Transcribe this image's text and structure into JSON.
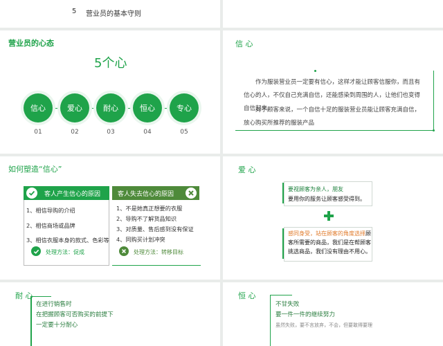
{
  "slide1": {
    "index": "5",
    "title": "营业员的基本守则"
  },
  "slide3": {
    "title": "营业员的心态",
    "heading": "5个心",
    "circles": [
      "信心",
      "爱心",
      "耐心",
      "恒心",
      "专心"
    ],
    "numbers": [
      "01",
      "02",
      "03",
      "04",
      "05"
    ]
  },
  "slide4": {
    "title": "信 心",
    "paragraph1": "作为服装营业员一定要有信心，这样才能让顾客信服你，而且有信心的人，不仅自己充满自信，还能感染到周围的人，让他们也变得自信起来。",
    "paragraph2": "对于顾客来说，一个自信十足的服装营业员能让顾客充满自信，放心购买所推荐的服装产品"
  },
  "slide5": {
    "title": "如何塑造“信心”",
    "left_header": "客人产生信心的原因",
    "left_items": [
      "1、相信导购的介绍",
      "2、相信商场或品牌",
      "3、相信衣服本身的款式、色彩等"
    ],
    "left_method": "处理方法：促成",
    "right_header": "客人失去信心的原因",
    "right_items": [
      "1、不是她真正想要的衣服",
      "2、导购不了解货品知识",
      "3、对质量、售后感到没有保证",
      "4、同购买计划冲突"
    ],
    "right_method": "处理方法：转移目标"
  },
  "slide6": {
    "title": "爱 心",
    "box1_line1": "要视顾客为亲人，朋友",
    "box1_line2": "要用你的服务让顾客感受得到。",
    "box2_prefix": "感同身受，站在顾客的角度选择",
    "box2_rest": "顾客所需要的商品，我们是在帮顾客挑选商品，我们没有理由不用心。",
    "colors": {
      "accent": "#1fa34a",
      "orange": "#e07a2a"
    }
  },
  "slide7": {
    "title": "耐 心",
    "lines": [
      "在进行销售时",
      "在把握顾客可否购买的前提下",
      "一定要十分耐心"
    ]
  },
  "slide8": {
    "title": "恒 心",
    "lines": [
      "不甘失败",
      "要一件一件的继续努力",
      "虽然失败，要不言放弃，不会，但要敢得要理"
    ]
  }
}
